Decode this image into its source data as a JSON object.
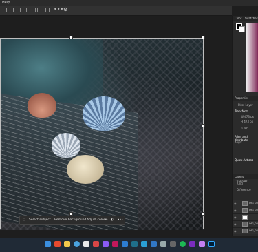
{
  "menubar": {
    "help_label": "Help"
  },
  "options_bar": {
    "more_label": "•••"
  },
  "contextual_taskbar": {
    "select_subject": "Select subject",
    "remove_background": "Remove background",
    "adjust_colors": "Adjust colors",
    "more_label": "•••"
  },
  "right_panel": {
    "color_tab": "Color",
    "swatches_tab": "Swatches",
    "properties_tab": "Properties",
    "adjustments_tab": "Adjustm",
    "pixel_layer_label": "Pixel Layer",
    "transform_label": "Transform",
    "w_value": "W  473 px",
    "h_value": "H  473 px",
    "angle_value": "0.00°",
    "align_label": "Align and distribute",
    "align_sub": "Align:",
    "quick_actions": "Quick Actions",
    "layers_tab": "Layers",
    "channels_tab": "Channels",
    "kind_label": "Kind",
    "blend_mode": "Difference",
    "layers": [
      {
        "name": "IMG_00"
      },
      {
        "name": "IMG_00"
      },
      {
        "name": ""
      },
      {
        "name": "IMG_00"
      },
      {
        "name": "IMG_00"
      },
      {
        "name": "IMG_00"
      }
    ]
  },
  "taskbar": {
    "icons": [
      "windows-start",
      "file-explorer",
      "store",
      "edge",
      "app",
      "app",
      "app",
      "app",
      "app",
      "app",
      "app",
      "app",
      "app",
      "app",
      "app",
      "app",
      "app",
      "spotify",
      "app",
      "photoshop",
      "app"
    ]
  },
  "colors": {
    "accent": "#31a8ff",
    "foreground_swatch": "#000000",
    "background_swatch": "#ffffff"
  }
}
